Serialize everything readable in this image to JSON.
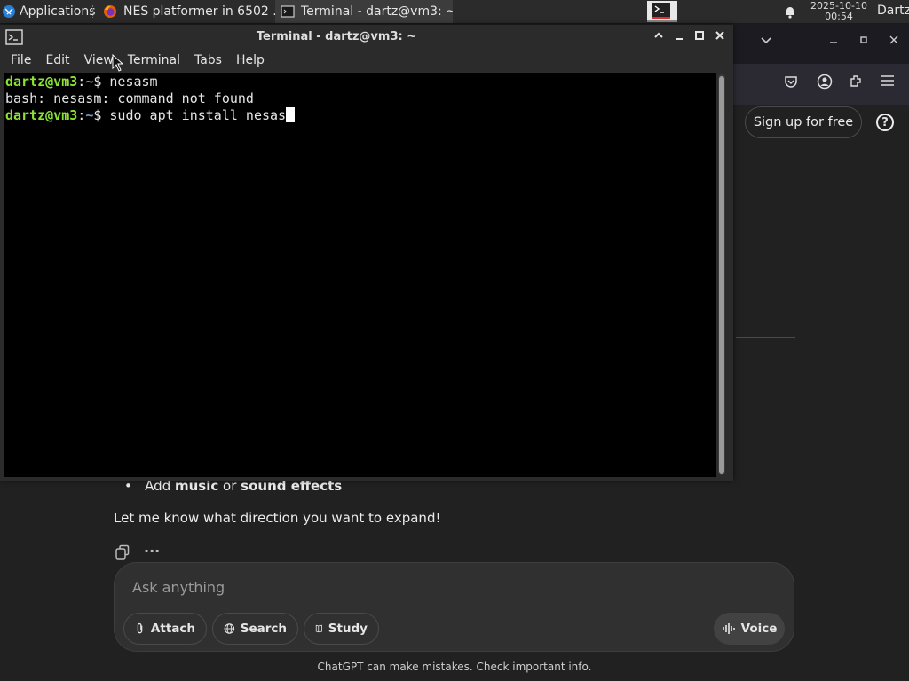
{
  "panel": {
    "applications": "Applications",
    "tasks": [
      {
        "label": "NES platformer in 6502 ..."
      },
      {
        "label": "Terminal - dartz@vm3: ~"
      }
    ],
    "date": "2025-10-10",
    "time": "00:54",
    "user": "Dartz"
  },
  "terminal": {
    "title": "Terminal - dartz@vm3: ~",
    "menu": [
      "File",
      "Edit",
      "View",
      "Terminal",
      "Tabs",
      "Help"
    ],
    "lines": [
      {
        "user": "dartz@vm3",
        "path": "~",
        "cmd": "nesasm"
      },
      {
        "output": "bash: nesasm: command not found"
      },
      {
        "user": "dartz@vm3",
        "path": "~",
        "cmd": "sudo apt install nesas"
      }
    ]
  },
  "browser": {
    "signup": "Sign up for free",
    "help": "?"
  },
  "chat": {
    "bullet_prefix": "Add ",
    "bullet_bold1": "music",
    "bullet_mid": " or ",
    "bullet_bold2": "sound effects",
    "expand_text": "Let me know what direction you want to expand!",
    "placeholder": "Ask anything",
    "attach": "Attach",
    "search": "Search",
    "study": "Study",
    "voice": "Voice",
    "disclaimer": "ChatGPT can make mistakes. Check important info."
  }
}
